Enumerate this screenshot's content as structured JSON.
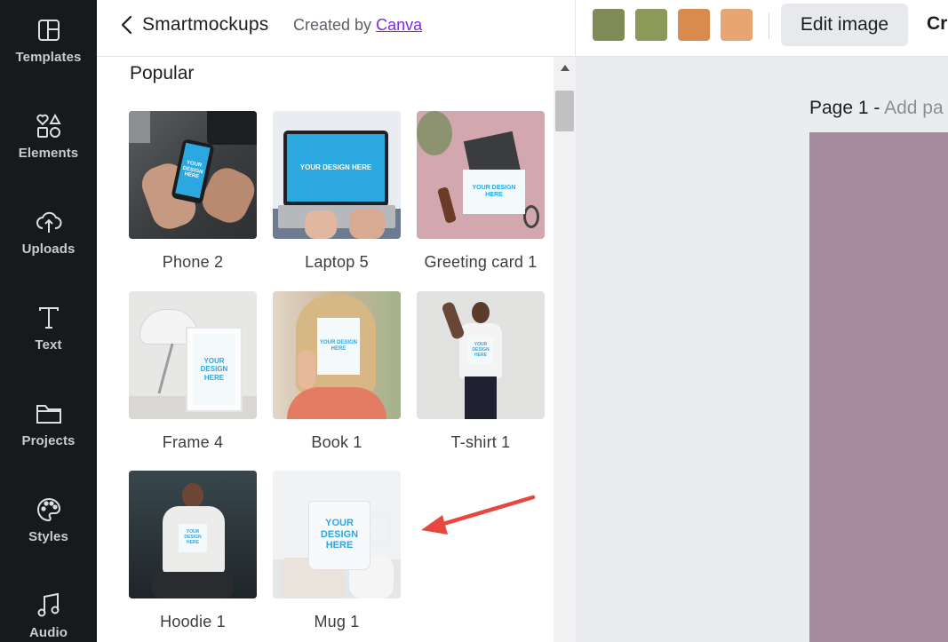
{
  "rail": {
    "items": [
      {
        "label": "Templates",
        "icon": "templates-icon"
      },
      {
        "label": "Elements",
        "icon": "elements-icon"
      },
      {
        "label": "Uploads",
        "icon": "uploads-icon"
      },
      {
        "label": "Text",
        "icon": "text-icon"
      },
      {
        "label": "Projects",
        "icon": "projects-icon"
      },
      {
        "label": "Styles",
        "icon": "styles-icon"
      },
      {
        "label": "Audio",
        "icon": "audio-icon"
      }
    ]
  },
  "panel": {
    "title": "Smartmockups",
    "created_by": "Created by",
    "brand_link": "Canva",
    "section": "Popular",
    "mockups": [
      {
        "label": "Phone 2",
        "design_text": "YOUR DESIGN HERE"
      },
      {
        "label": "Laptop 5",
        "design_text": "YOUR DESIGN HERE"
      },
      {
        "label": "Greeting card 1",
        "design_text": "YOUR DESIGN HERE"
      },
      {
        "label": "Frame 4",
        "design_text": "YOUR DESIGN HERE"
      },
      {
        "label": "Book 1",
        "design_text": "YOUR DESIGN HERE"
      },
      {
        "label": "T-shirt 1",
        "design_text": "YOUR DESIGN HERE"
      },
      {
        "label": "Hoodie 1",
        "design_text": "YOUR DESIGN HERE"
      },
      {
        "label": "Mug 1",
        "design_text": "YOUR DESIGN HERE"
      }
    ]
  },
  "toolbar": {
    "swatches": [
      "#7f8b57",
      "#8b9a5b",
      "#d98b4f",
      "#e8a574"
    ],
    "edit_image": "Edit image",
    "crop_partial": "Cr"
  },
  "canvas": {
    "page_label": "Page 1 -",
    "add_page_title": "Add pa",
    "page_color": "#a68a9d"
  },
  "annotation": {
    "arrow_color": "#e8473f"
  }
}
